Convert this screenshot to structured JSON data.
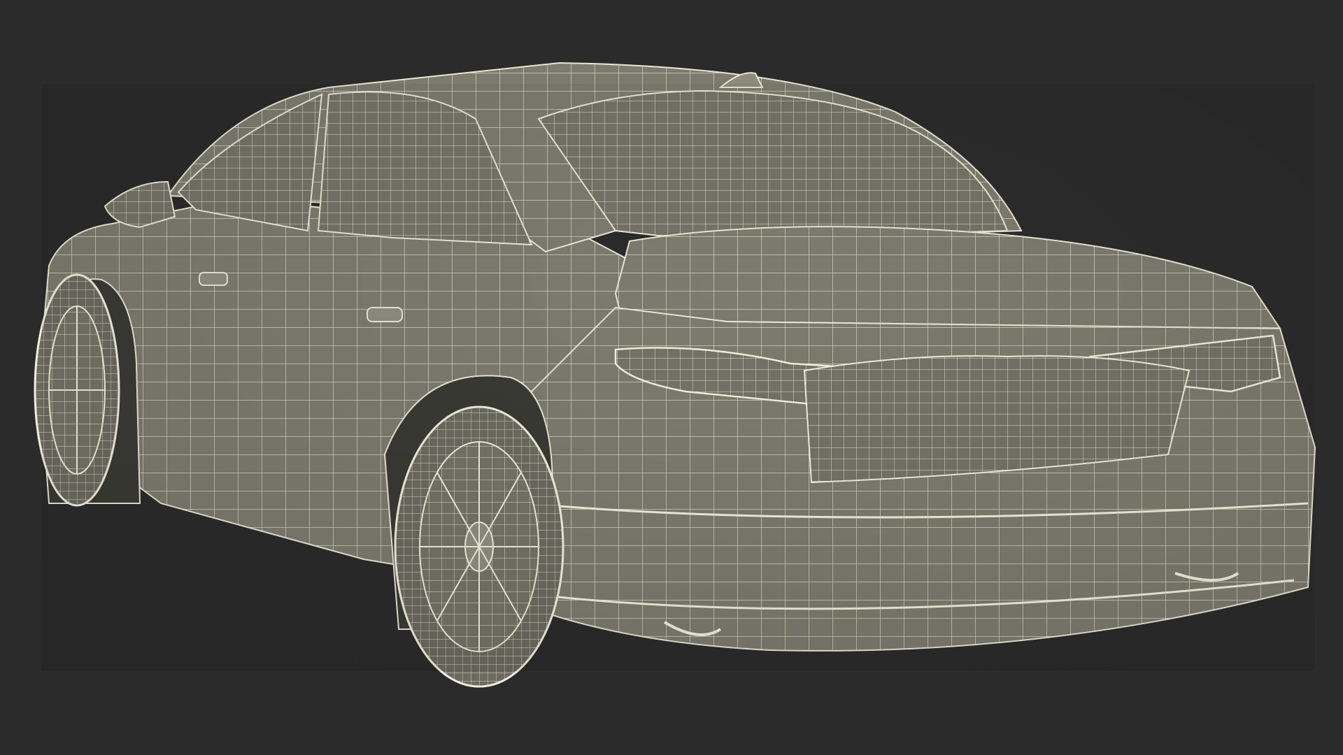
{
  "scene": {
    "background_color": "#2b2b2b",
    "surface_color": "#7d7d70",
    "surface_shadow_color": "#5f5f56",
    "wire_color": "#e9e6d3",
    "subject": "wireframe-sedan-rear-three-quarter-view"
  }
}
